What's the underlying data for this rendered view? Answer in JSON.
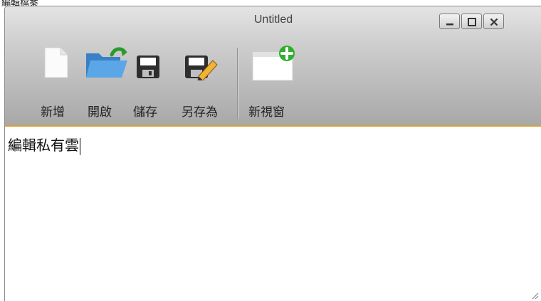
{
  "window": {
    "title": "Untitled"
  },
  "toolbar": {
    "new_label": "新增",
    "open_label": "開啟",
    "save_label": "儲存",
    "save_as_label": "另存為",
    "new_window_label": "新視窗"
  },
  "editor": {
    "content": "編輯私有雲"
  },
  "icons": {
    "new": "blank-document-icon",
    "open": "open-folder-icon",
    "save": "floppy-disk-icon",
    "save_as": "floppy-pencil-icon",
    "new_window": "window-plus-icon",
    "minimize": "minimize-icon",
    "maximize": "maximize-icon",
    "close": "close-icon"
  },
  "colors": {
    "titlebar_top": "#e4e4e4",
    "titlebar_bottom": "#a8a8a8",
    "editor_focus_border": "#d8a23a",
    "folder_blue": "#4a93d6",
    "add_green": "#2fae2f"
  }
}
